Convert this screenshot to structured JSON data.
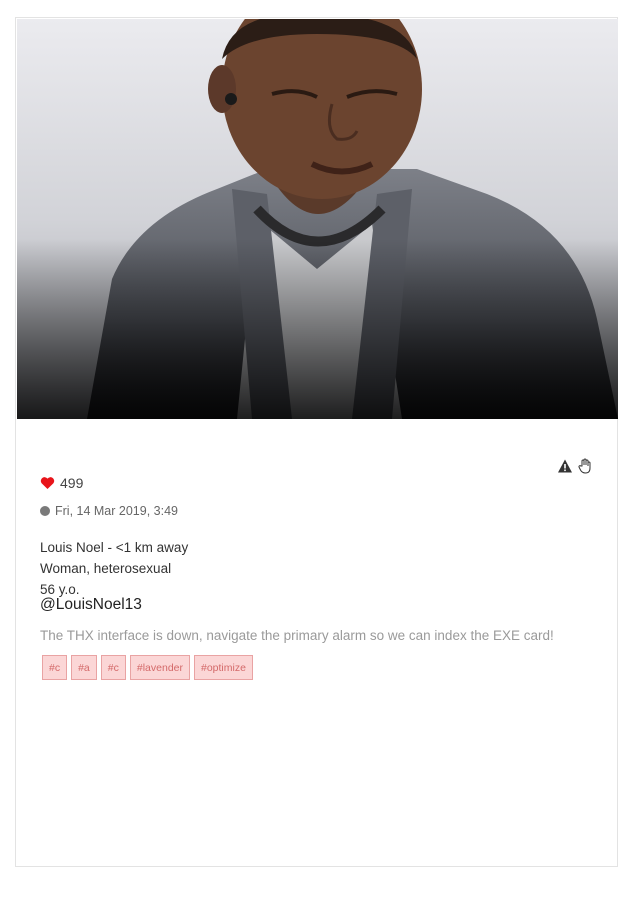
{
  "profile": {
    "photo_alt": "profile-photo",
    "likes": "499",
    "date": "Fri, 14 Mar 2019, 3:49",
    "name_line": "Louis Noel - <1 km away",
    "gender_line": "Woman, heterosexual",
    "age_line": "56 y.o.",
    "handle": "@LouisNoel13",
    "message": "The THX interface is down, navigate the primary alarm so we can index the EXE card!",
    "tags": [
      "#c",
      "#a",
      "#c",
      "#lavender",
      "#optimize"
    ]
  },
  "icons": {
    "heart": "heart-icon",
    "report": "warning-icon",
    "block": "hand-icon",
    "status": "status-dot-icon"
  },
  "colors": {
    "heart": "#e8141a",
    "tag_bg": "#fbd6d6",
    "tag_text": "#d46a6a",
    "status_dot": "#7a7a7a"
  }
}
